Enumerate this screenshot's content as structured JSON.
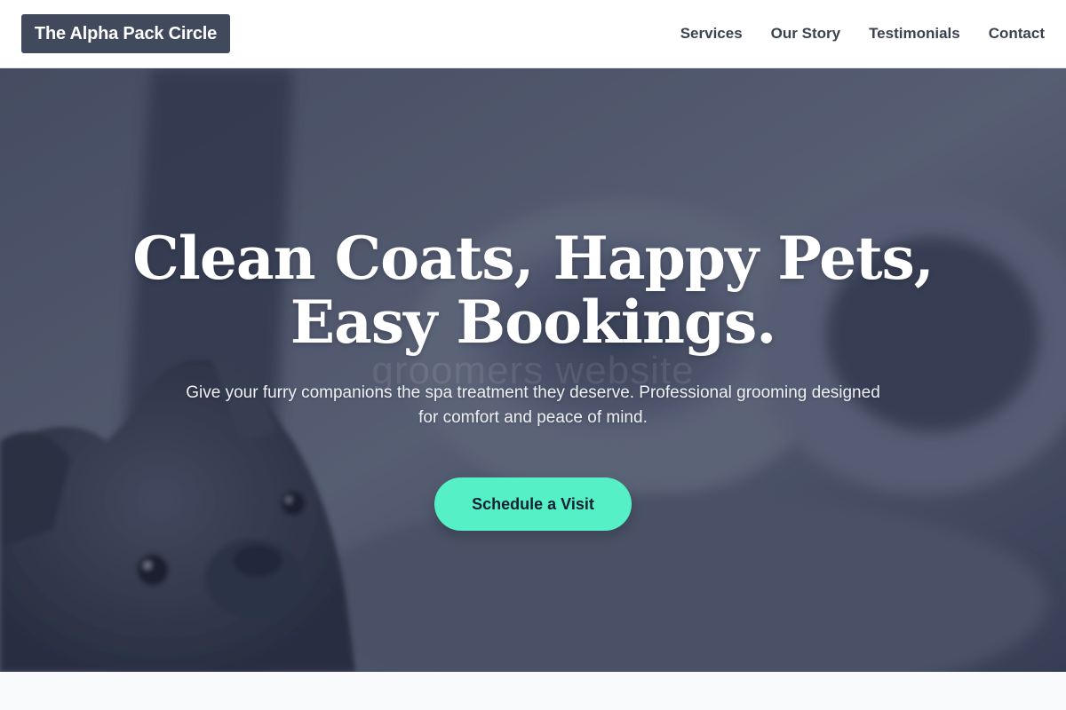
{
  "nav": {
    "brand": "The Alpha Pack Circle",
    "links": [
      "Services",
      "Our Story",
      "Testimonials",
      "Contact"
    ]
  },
  "hero": {
    "headline_line1": "Clean Coats, Happy Pets,",
    "headline_line2": "Easy Bookings.",
    "watermark": "groomers website",
    "subtitle": "Give your furry companions the spa treatment they deserve. Professional grooming designed for comfort and peace of mind.",
    "cta_label": "Schedule a Visit"
  },
  "colors": {
    "brand_bg": "#404a5c",
    "cta": "#55f0c6",
    "hero_tint": "#5a6072",
    "page_bg": "#f8fafc"
  }
}
